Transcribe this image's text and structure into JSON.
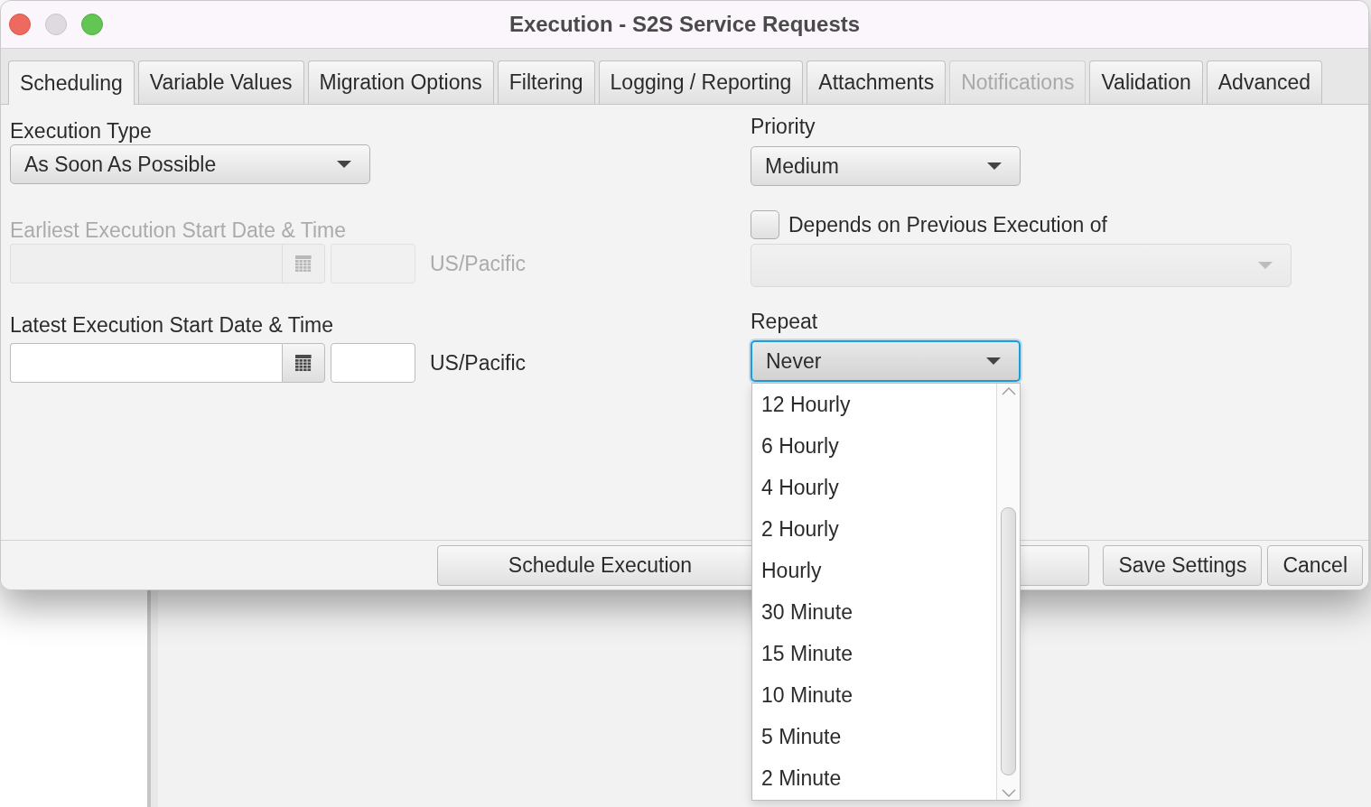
{
  "window": {
    "title": "Execution - S2S Service Requests"
  },
  "tabs": [
    {
      "label": "Scheduling",
      "selected": true,
      "disabled": false
    },
    {
      "label": "Variable Values",
      "selected": false,
      "disabled": false
    },
    {
      "label": "Migration Options",
      "selected": false,
      "disabled": false
    },
    {
      "label": "Filtering",
      "selected": false,
      "disabled": false
    },
    {
      "label": "Logging / Reporting",
      "selected": false,
      "disabled": false
    },
    {
      "label": "Attachments",
      "selected": false,
      "disabled": false
    },
    {
      "label": "Notifications",
      "selected": false,
      "disabled": true
    },
    {
      "label": "Validation",
      "selected": false,
      "disabled": false
    },
    {
      "label": "Advanced",
      "selected": false,
      "disabled": false
    }
  ],
  "scheduling": {
    "execution_type": {
      "label": "Execution Type",
      "value": "As Soon As Possible"
    },
    "earliest_start": {
      "label": "Earliest Execution Start Date & Time",
      "timezone": "US/Pacific",
      "disabled": true
    },
    "latest_start": {
      "label": "Latest Execution Start Date & Time",
      "timezone": "US/Pacific",
      "disabled": false
    },
    "priority": {
      "label": "Priority",
      "value": "Medium"
    },
    "depends_on": {
      "label": "Depends on Previous Execution of",
      "checked": false,
      "select_disabled": true
    },
    "repeat": {
      "label": "Repeat",
      "value": "Never",
      "focused": true,
      "expanded": true,
      "options": [
        {
          "label": "12 Hourly",
          "selected": false
        },
        {
          "label": "6 Hourly",
          "selected": false
        },
        {
          "label": "4 Hourly",
          "selected": false
        },
        {
          "label": "2 Hourly",
          "selected": false
        },
        {
          "label": "Hourly",
          "selected": false
        },
        {
          "label": "30 Minute",
          "selected": false
        },
        {
          "label": "15 Minute",
          "selected": false
        },
        {
          "label": "10 Minute",
          "selected": false
        },
        {
          "label": "5 Minute",
          "selected": false
        },
        {
          "label": "2 Minute",
          "selected": false
        }
      ]
    }
  },
  "buttons": [
    {
      "label": "Schedule Execution"
    },
    {
      "label": "Save Settings"
    },
    {
      "label": "Cancel"
    }
  ]
}
